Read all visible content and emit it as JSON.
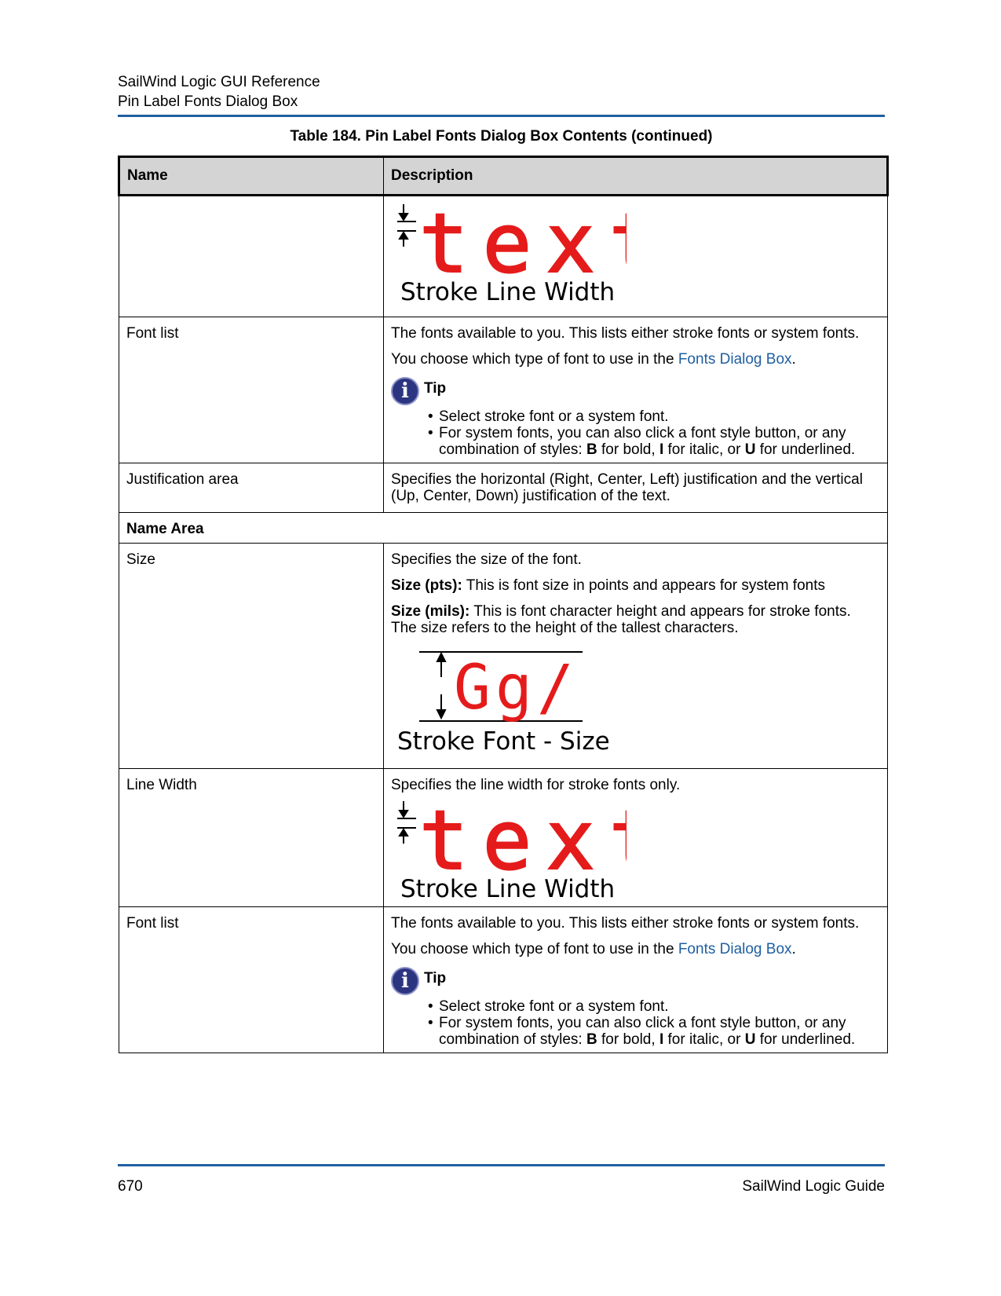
{
  "header": {
    "line1": "SailWind Logic GUI Reference",
    "line2": "Pin Label Fonts Dialog Box"
  },
  "table_title": "Table 184. Pin Label Fonts Dialog Box Contents (continued)",
  "columns": {
    "name": "Name",
    "description": "Description"
  },
  "figures": {
    "line_width_text": "text",
    "line_width_caption": "Stroke Line Width",
    "size_glyphs": "Gg/",
    "size_caption": "Stroke Font - Size",
    "glyph_color": "#e51b1b"
  },
  "rows": {
    "font_list_1": {
      "name": "Font list",
      "desc1": "The fonts available to you. This lists either stroke fonts or system fonts.",
      "desc2_pre": "You choose which type of font to use in the ",
      "desc2_link": "Fonts Dialog Box",
      "desc2_post": ".",
      "tip_label": "Tip",
      "tip1": "Select stroke font or a system font.",
      "tip2_a": "For system fonts, you can also click a font style button, or any combination of styles: ",
      "tip2_b": "B",
      "tip2_c": " for bold, ",
      "tip2_d": "I",
      "tip2_e": " for italic, or ",
      "tip2_f": "U",
      "tip2_g": " for underlined."
    },
    "justification": {
      "name": "Justification area",
      "desc": "Specifies the horizontal (Right, Center, Left) justification and the vertical (Up, Center, Down) justification of the text."
    },
    "section": "Name Area",
    "size": {
      "name": "Size",
      "desc1": "Specifies the size of the font.",
      "pts_label": "Size (pts):",
      "pts_text": " This is font size in points and appears for system fonts",
      "mils_label": "Size (mils):",
      "mils_text": " This is font character height and appears for stroke fonts. The size refers to the height of the tallest characters."
    },
    "line_width": {
      "name": "Line Width",
      "desc": "Specifies the line width for stroke fonts only."
    },
    "font_list_2": {
      "name": "Font list",
      "desc1": "The fonts available to you. This lists either stroke fonts or system fonts.",
      "desc2_pre": "You choose which type of font to use in the ",
      "desc2_link": "Fonts Dialog Box",
      "desc2_post": ".",
      "tip_label": "Tip",
      "tip1": "Select stroke font or a system font.",
      "tip2_a": "For system fonts, you can also click a font style button, or any combination of styles: ",
      "tip2_b": "B",
      "tip2_c": " for bold, ",
      "tip2_d": "I",
      "tip2_e": " for italic, or ",
      "tip2_f": "U",
      "tip2_g": " for underlined."
    }
  },
  "footer": {
    "page": "670",
    "guide": "SailWind Logic Guide"
  }
}
